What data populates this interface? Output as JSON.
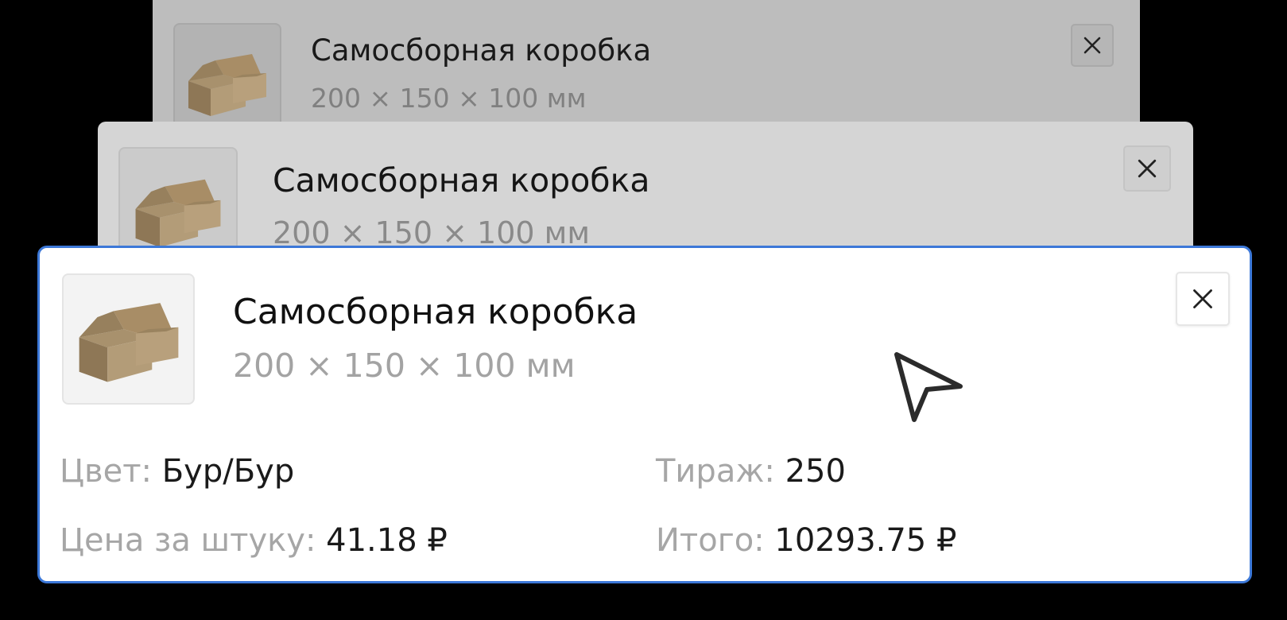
{
  "cards": [
    {
      "layer": "back",
      "title": "Самосборная коробка",
      "dimensions": "200 × 150 × 100 мм",
      "close_icon": "close-icon"
    },
    {
      "layer": "middle",
      "title": "Самосборная коробка",
      "dimensions": "200 × 150 × 100 мм",
      "close_icon": "close-icon"
    },
    {
      "layer": "front",
      "title": "Самосборная коробка",
      "dimensions": "200 × 150 × 100 мм",
      "close_icon": "close-icon",
      "details": {
        "color": {
          "label": "Цвет:",
          "value": "Бур/Бур"
        },
        "run": {
          "label": "Тираж:",
          "value": "250"
        },
        "unit_price": {
          "label": "Цена за штуку:",
          "value": "41.18 ₽"
        },
        "total": {
          "label": "Итого:",
          "value": "10293.75 ₽"
        }
      }
    }
  ],
  "colors": {
    "accent_border": "#3c78d8",
    "box_kraft": "#a88d66",
    "background": "#000000"
  },
  "cursor_icon": "pointer-arrow-icon"
}
